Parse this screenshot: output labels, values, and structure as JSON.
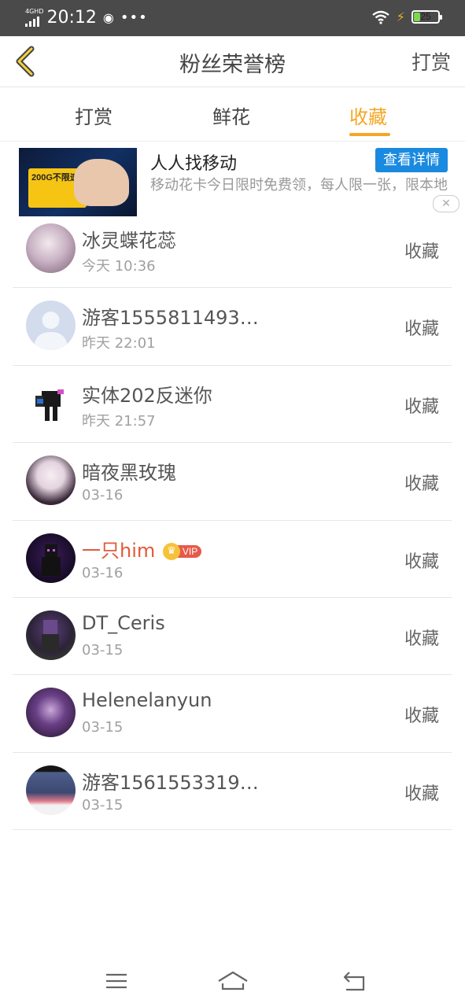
{
  "status": {
    "network": "4GHD",
    "time": "20:12",
    "dots": "•••",
    "battery": "25"
  },
  "nav": {
    "title": "粉丝荣誉榜",
    "right_label": "打赏"
  },
  "tabs": [
    {
      "label": "打赏"
    },
    {
      "label": "鲜花"
    },
    {
      "label": "收藏",
      "active": true
    }
  ],
  "ad": {
    "title": "人人找移动",
    "button": "查看详情",
    "desc": "移动花卡今日限时免费领，每人限一张，限本地",
    "card_text": "200G不限速",
    "close": "✕"
  },
  "fans": [
    {
      "name": "冰灵蝶花蕊",
      "time": "今天 10:36",
      "action": "收藏"
    },
    {
      "name": "游客1555811493…",
      "time": "昨天 22:01",
      "action": "收藏"
    },
    {
      "name": "实体202反迷你",
      "time": "昨天 21:57",
      "action": "收藏"
    },
    {
      "name": "暗夜黑玫瑰",
      "time": "03-16",
      "action": "收藏"
    },
    {
      "name": "一只him",
      "time": "03-16",
      "action": "收藏",
      "vip": "VIP"
    },
    {
      "name": "DT_Ceris",
      "time": "03-15",
      "action": "收藏"
    },
    {
      "name": "Helenelanyun",
      "time": "03-15",
      "action": "收藏"
    },
    {
      "name": "游客1561553319…",
      "time": "03-15",
      "action": "收藏"
    }
  ],
  "colors": {
    "accent": "#f5a623",
    "ad_button": "#1a8ae0",
    "vip_name": "#e05a3a"
  }
}
